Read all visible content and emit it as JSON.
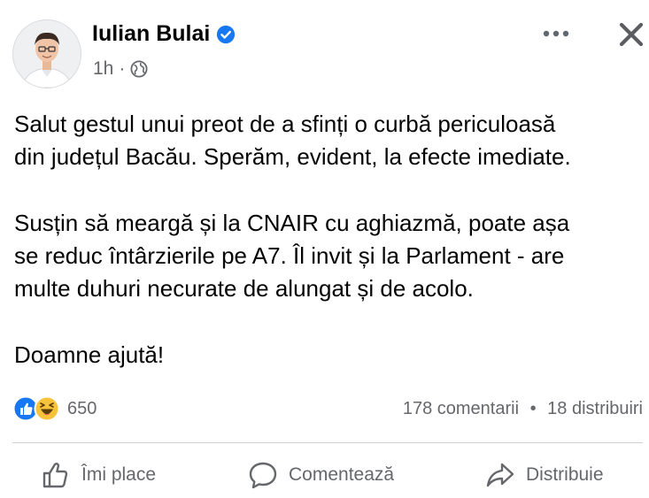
{
  "post": {
    "author": "Iulian Bulai",
    "time": "1h",
    "meta_separator": "·",
    "paragraphs": [
      "Salut gestul unui preot de a sfinți o curbă periculoasă\ndin județul Bacău. Sperăm, evident, la efecte imediate.",
      "Susțin să meargă și la CNAIR cu aghiazmă, poate așa\nse reduc întârzierile pe A7. Îl invit și la Parlament - are\nmulte duhuri necurate de alungat și de acolo.",
      "Doamne ajută!"
    ]
  },
  "stats": {
    "reactions_count": "650",
    "comments": "178 comentarii",
    "separator": "•",
    "shares": "18 distribuiri"
  },
  "actions": {
    "like": "Îmi place",
    "comment": "Comentează",
    "share": "Distribuie"
  },
  "icons": {
    "verified": "verified-badge-icon",
    "privacy": "globe-icon",
    "more": "more-options-icon",
    "close": "close-icon",
    "reactions": [
      "like-reaction-icon",
      "haha-reaction-icon"
    ]
  },
  "colors": {
    "accent": "#1877f2",
    "secondary_text": "#65676b",
    "divider": "#ced0d4"
  }
}
